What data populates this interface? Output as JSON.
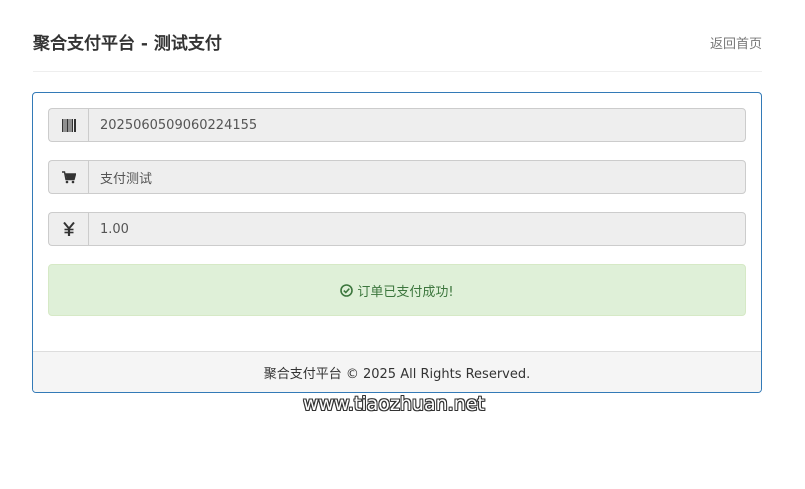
{
  "header": {
    "title": "聚合支付平台 - 测试支付",
    "back_link": "返回首页"
  },
  "form": {
    "order_no": "2025060509060224155",
    "product_name": "支付测试",
    "amount": "1.00"
  },
  "icons": {
    "order_no": "barcode-icon",
    "product_name": "shopping-cart-icon",
    "amount": "yen-icon",
    "alert": "check-circle-icon"
  },
  "alert": {
    "message": "订单已支付成功!"
  },
  "footer": {
    "copyright": "聚合支付平台 © 2025 All Rights Reserved."
  },
  "watermark": {
    "text": "www.tiaozhuan.net"
  },
  "colors": {
    "panel_border": "#337ab7",
    "alert_bg": "#dff0d8",
    "alert_text": "#3c763d"
  }
}
